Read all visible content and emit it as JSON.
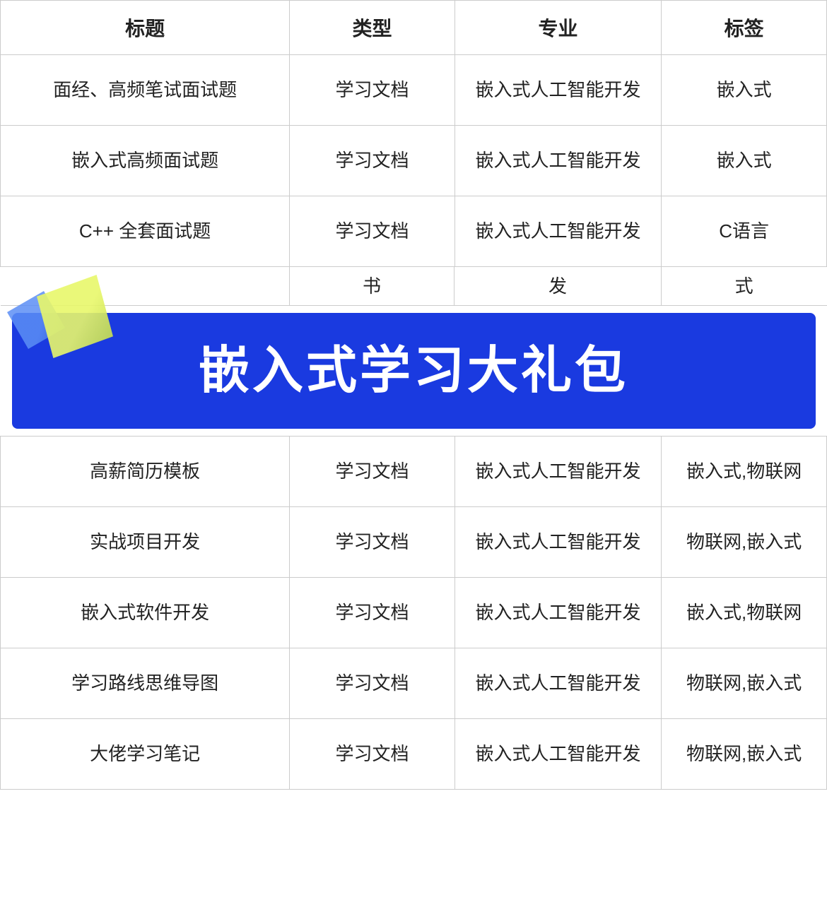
{
  "table": {
    "headers": [
      "标题",
      "类型",
      "专业",
      "标签"
    ],
    "rows": [
      {
        "title": "面经、高频笔试面试题",
        "type": "学习文档",
        "major": "嵌入式人工智能开发",
        "tag": "嵌入式"
      },
      {
        "title": "嵌入式高频面试题",
        "type": "学习文档",
        "major": "嵌入式人工智能开发",
        "tag": "嵌入式"
      },
      {
        "title": "C++ 全套面试题",
        "type": "学习文档",
        "major": "嵌入式人工智能开发",
        "tag": "C语言"
      }
    ],
    "partial_row": {
      "title": "",
      "type": "书",
      "major": "发",
      "tag": "式"
    },
    "rows2": [
      {
        "title": "高薪简历模板",
        "type": "学习文档",
        "major": "嵌入式人工智能开发",
        "tag": "嵌入式,物联网"
      },
      {
        "title": "实战项目开发",
        "type": "学习文档",
        "major": "嵌入式人工智能开发",
        "tag": "物联网,嵌入式"
      },
      {
        "title": "嵌入式软件开发",
        "type": "学习文档",
        "major": "嵌入式人工智能开发",
        "tag": "嵌入式,物联网"
      },
      {
        "title": "学习路线思维导图",
        "type": "学习文档",
        "major": "嵌入式人工智能开发",
        "tag": "物联网,嵌入式"
      },
      {
        "title": "大佬学习笔记",
        "type": "学习文档",
        "major": "嵌入式人工智能开发",
        "tag": "物联网,嵌入式"
      }
    ],
    "banner_text": "嵌入式学习大礼包"
  }
}
